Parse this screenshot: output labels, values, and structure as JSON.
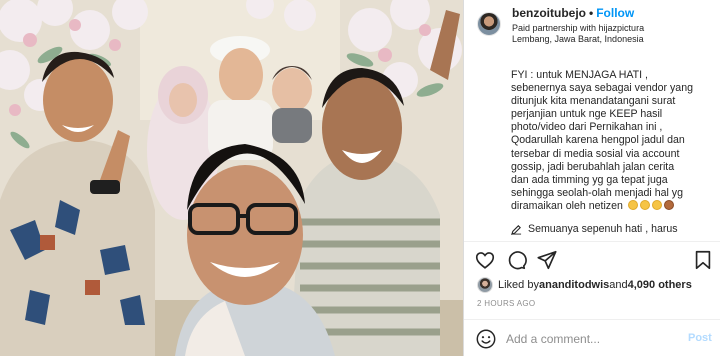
{
  "post": {
    "username": "benzoitubejo",
    "separator": "•",
    "follow_label": "Follow",
    "partnership_prefix": "Paid partnership with ",
    "partner_name": "hijazpictura",
    "location": "Lembang, Jawa Barat, Indonesia"
  },
  "caption": {
    "lines": [
      "FYI : untuk MENJAGA HATI ,",
      "sebenernya saya sebagai vendor yang",
      "ditunjuk kita menandatangani surat",
      "perjanjian untuk nge KEEP hasil",
      "photo/video dari Pernikahan ini ,",
      "Qodarullah karena hengpol jadul dan",
      "tersebar di media sosial via account",
      "gossip, jadi berubahlah jalan cerita",
      "dan ada timming yg ga tepat juga",
      "sehingga seolah-olah menjadi hal yg",
      "diramaikan oleh netizen"
    ],
    "next_line": "Semuanya sepenuh hati , harus"
  },
  "actions": {
    "like": "heart-icon",
    "comment": "comment-icon",
    "share": "paper-plane-icon",
    "save": "bookmark-icon"
  },
  "likes": {
    "prefix": "Liked by ",
    "liker": "ananditodwis",
    "middle": " and ",
    "count": "4,090 others"
  },
  "timestamp": "2 HOURS AGO",
  "comment": {
    "placeholder": "Add a comment...",
    "post_label": "Post"
  },
  "colors": {
    "accent": "#0095f6",
    "post_disabled": "#b3dbff",
    "muted": "#8e8e8e",
    "text": "#262626"
  }
}
